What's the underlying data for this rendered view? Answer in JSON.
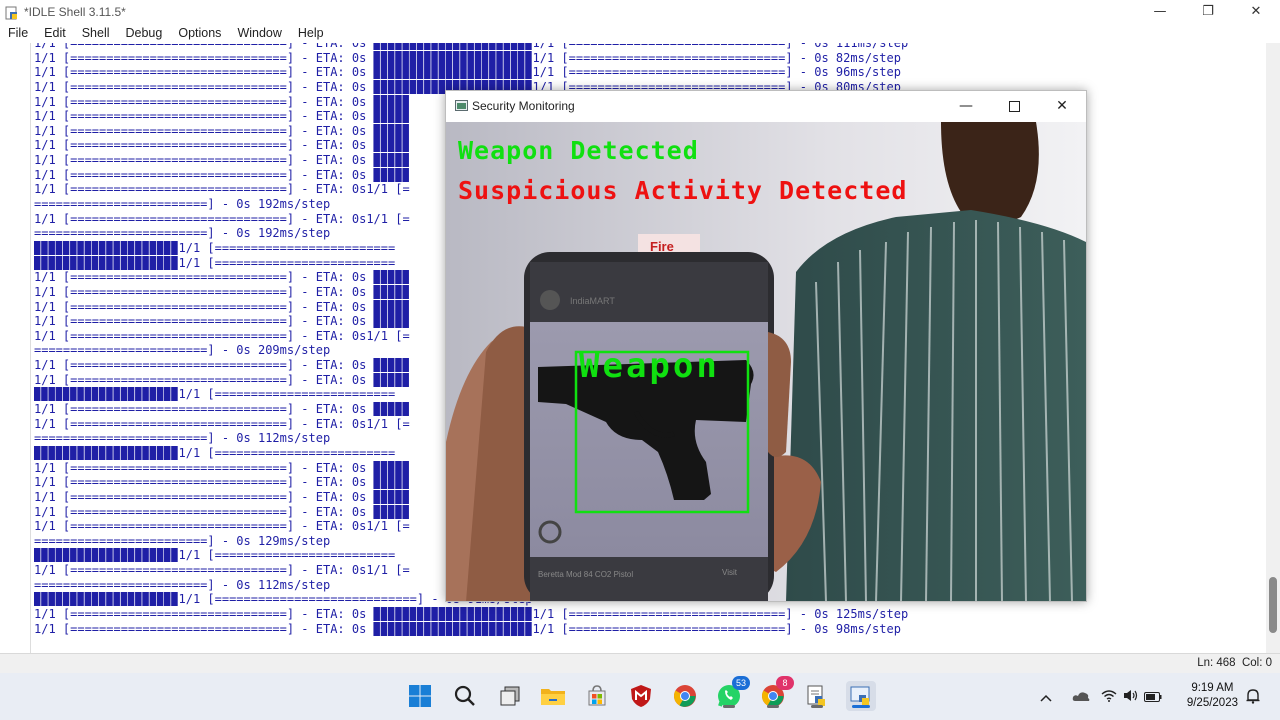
{
  "idle": {
    "title": "*IDLE Shell 3.11.5*",
    "menu": [
      "File",
      "Edit",
      "Shell",
      "Debug",
      "Options",
      "Window",
      "Help"
    ],
    "status": {
      "ln": "Ln: 468",
      "col": "Col: 0"
    },
    "output_lines": [
      "1/1 [==============================] - ETA: 0s ▉▉▉▉▉▉▉▉▉▉▉▉▉▉▉▉▉▉▉▉▉▉1/1 [==============================] - 0s 111ms/step",
      "1/1 [==============================] - ETA: 0s ▉▉▉▉▉▉▉▉▉▉▉▉▉▉▉▉▉▉▉▉▉▉1/1 [==============================] - 0s 82ms/step",
      "1/1 [==============================] - ETA: 0s ▉▉▉▉▉▉▉▉▉▉▉▉▉▉▉▉▉▉▉▉▉▉1/1 [==============================] - 0s 96ms/step",
      "1/1 [==============================] - ETA: 0s ▉▉▉▉▉▉▉▉▉▉▉▉▉▉▉▉▉▉▉▉▉▉1/1 [==============================] - 0s 80ms/step",
      "1/1 [==============================] - ETA: 0s ▉▉▉▉▉",
      "1/1 [==============================] - ETA: 0s ▉▉▉▉▉",
      "1/1 [==============================] - ETA: 0s ▉▉▉▉▉",
      "1/1 [==============================] - ETA: 0s ▉▉▉▉▉",
      "1/1 [==============================] - ETA: 0s ▉▉▉▉▉",
      "1/1 [==============================] - ETA: 0s ▉▉▉▉▉",
      "1/1 [==============================] - ETA: 0s1/1 [=",
      "========================] - 0s 192ms/step",
      "1/1 [==============================] - ETA: 0s1/1 [=",
      "========================] - 0s 192ms/step",
      "▉▉▉▉▉▉▉▉▉▉▉▉▉▉▉▉▉▉▉▉1/1 [=========================",
      "▉▉▉▉▉▉▉▉▉▉▉▉▉▉▉▉▉▉▉▉1/1 [=========================",
      "1/1 [==============================] - ETA: 0s ▉▉▉▉▉",
      "1/1 [==============================] - ETA: 0s ▉▉▉▉▉",
      "1/1 [==============================] - ETA: 0s ▉▉▉▉▉",
      "1/1 [==============================] - ETA: 0s ▉▉▉▉▉",
      "1/1 [==============================] - ETA: 0s1/1 [=",
      "========================] - 0s 209ms/step",
      "1/1 [==============================] - ETA: 0s ▉▉▉▉▉",
      "1/1 [==============================] - ETA: 0s ▉▉▉▉▉",
      "▉▉▉▉▉▉▉▉▉▉▉▉▉▉▉▉▉▉▉▉1/1 [=========================",
      "1/1 [==============================] - ETA: 0s ▉▉▉▉▉",
      "1/1 [==============================] - ETA: 0s1/1 [=",
      "========================] - 0s 112ms/step",
      "▉▉▉▉▉▉▉▉▉▉▉▉▉▉▉▉▉▉▉▉1/1 [=========================",
      "1/1 [==============================] - ETA: 0s ▉▉▉▉▉",
      "1/1 [==============================] - ETA: 0s ▉▉▉▉▉",
      "1/1 [==============================] - ETA: 0s ▉▉▉▉▉",
      "1/1 [==============================] - ETA: 0s ▉▉▉▉▉",
      "1/1 [==============================] - ETA: 0s1/1 [=",
      "========================] - 0s 129ms/step",
      "▉▉▉▉▉▉▉▉▉▉▉▉▉▉▉▉▉▉▉▉1/1 [=========================",
      "1/1 [==============================] - ETA: 0s1/1 [=",
      "========================] - 0s 112ms/step",
      "▉▉▉▉▉▉▉▉▉▉▉▉▉▉▉▉▉▉▉▉1/1 [============================] - 0s 91ms/step",
      "1/1 [==============================] - ETA: 0s ▉▉▉▉▉▉▉▉▉▉▉▉▉▉▉▉▉▉▉▉▉▉1/1 [==============================] - 0s 125ms/step",
      "1/1 [==============================] - ETA: 0s ▉▉▉▉▉▉▉▉▉▉▉▉▉▉▉▉▉▉▉▉▉▉1/1 [==============================] - 0s 98ms/step"
    ]
  },
  "monitor": {
    "title": "Security Monitoring",
    "alert_weapon": "Weapon Detected",
    "alert_suspicious": "Suspicious Activity Detected",
    "box_label": "Weapon",
    "colors": {
      "weapon_green": "#10e010",
      "suspicious_red": "#ee1111"
    },
    "scene_text": {
      "sign": "Fire",
      "phone_app": "IndiaMART",
      "caption": "Beretta Mod 84 CO2 Pistol",
      "caption_right": "Visit"
    }
  },
  "taskbar": {
    "badges": {
      "whatsapp": "53",
      "chrome2": "8"
    },
    "time": "9:19 AM",
    "date": "9/25/2023",
    "icons": [
      "windows-start-icon",
      "search-icon",
      "task-view-icon",
      "file-explorer-icon",
      "microsoft-store-icon",
      "mcafee-icon",
      "chrome-icon",
      "whatsapp-icon",
      "chrome-profile-icon",
      "notepad-icon",
      "idle-python-icon"
    ]
  }
}
